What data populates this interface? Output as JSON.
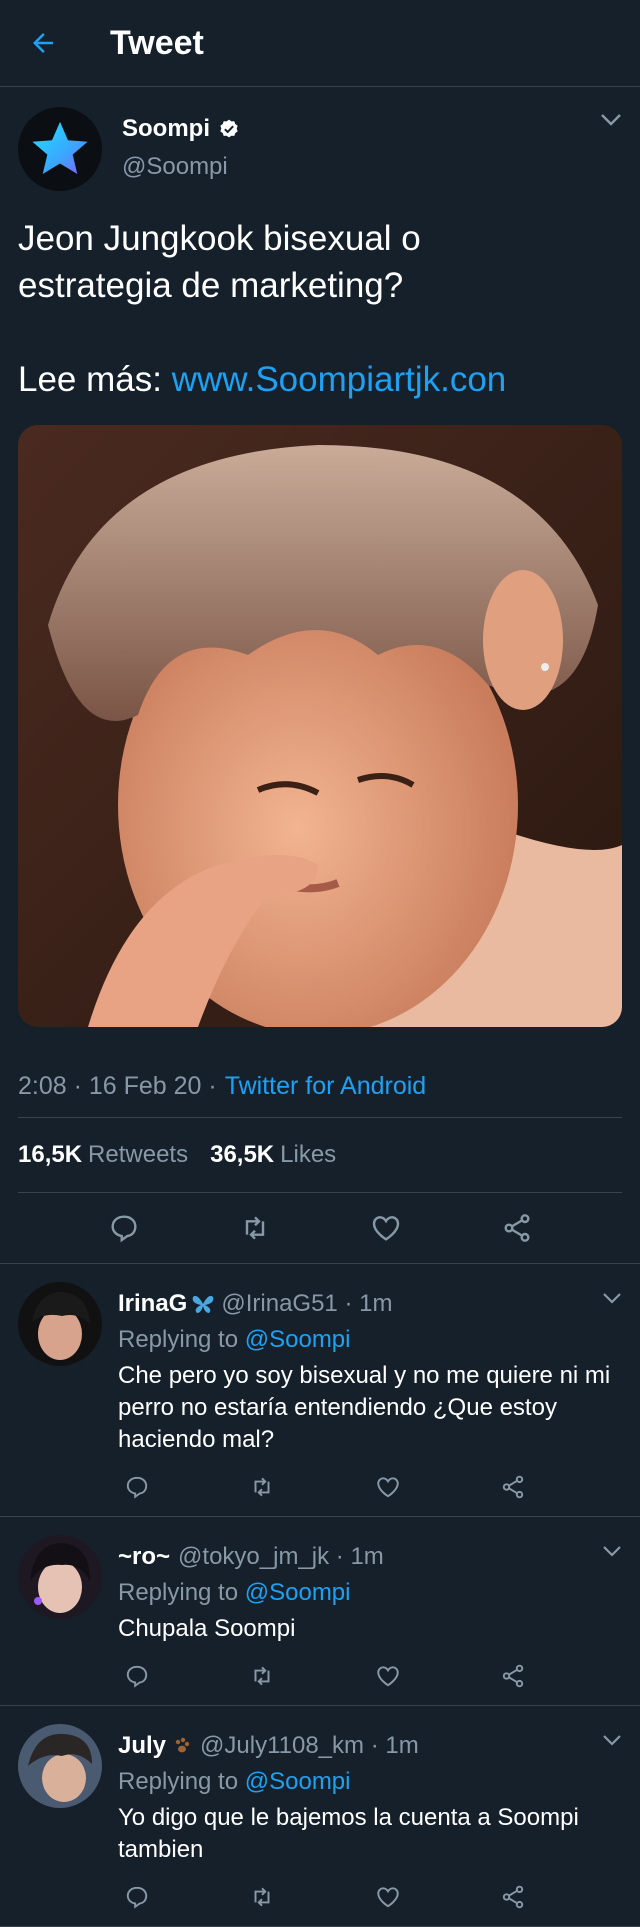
{
  "header": {
    "title": "Tweet",
    "back_icon": "arrow-left-icon"
  },
  "tweet": {
    "author_name": "Soompi",
    "author_handle": "@Soompi",
    "text_line1": "Jeon Jungkook bisexual o",
    "text_line2": "estrategia de marketing?",
    "read_more_label": "Lee más:",
    "link": "www.Soompiartjk.con",
    "time": "2:08 · 16 Feb 20 ·",
    "source": "Twitter for Android",
    "retweets_count": "16,5K",
    "retweets_label": "Retweets",
    "likes_count": "36,5K",
    "likes_label": "Likes"
  },
  "replies": [
    {
      "name": "IrinaG",
      "handle_time": "@IrinaG51 · 1m",
      "replying_label": "Replying to",
      "replying_to": "@Soompi",
      "text": "Che pero yo soy bisexual y no me quiere ni mi perro no estaría entendiendo ¿Que estoy haciendo mal?"
    },
    {
      "name": "~ro~",
      "handle_time": "@tokyo_jm_jk · 1m",
      "replying_label": "Replying to",
      "replying_to": "@Soompi",
      "text": "Chupala Soompi"
    },
    {
      "name": "July",
      "handle_time": "@July1108_km · 1m",
      "replying_label": "Replying to",
      "replying_to": "@Soompi",
      "text": "Yo digo que le bajemos la cuenta a Soompi tambien"
    }
  ],
  "colors": {
    "background": "#15202b",
    "accent": "#1da1f2",
    "muted": "#8899a6",
    "border": "#38444d"
  }
}
